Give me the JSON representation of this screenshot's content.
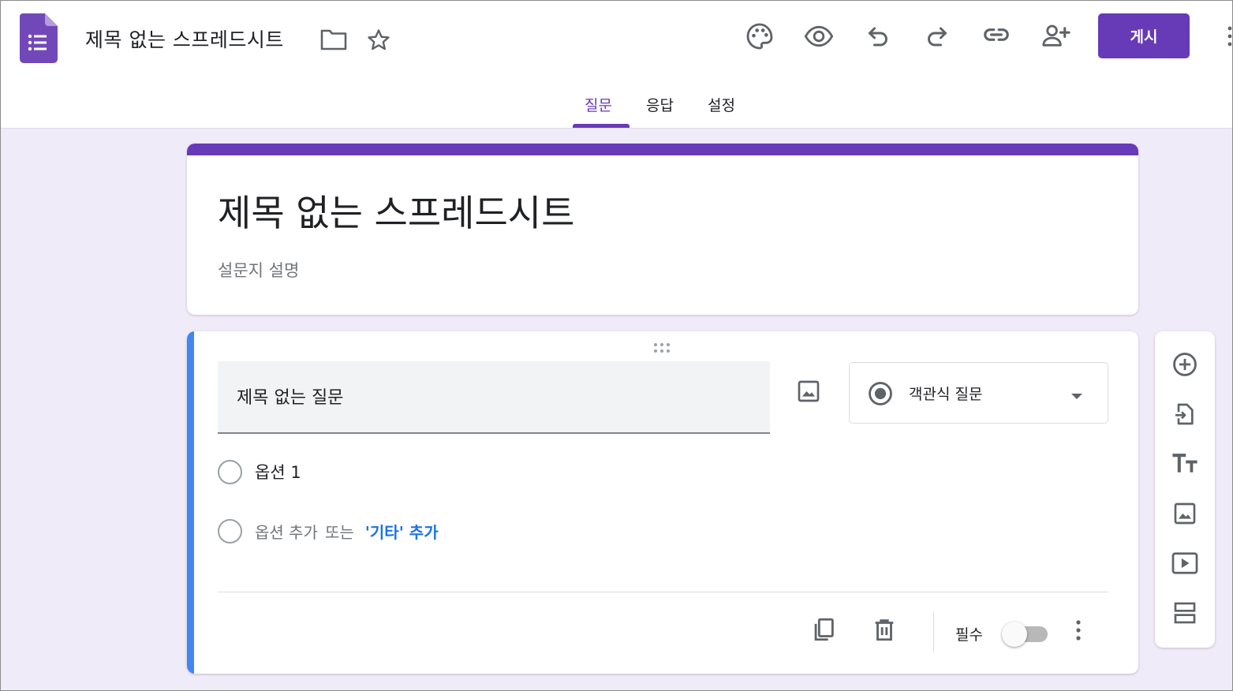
{
  "header": {
    "doc_title": "제목 없는 스프레드시트",
    "publish_label": "게시",
    "icons": [
      "forms-logo-icon",
      "folder-icon",
      "star-icon",
      "palette-icon",
      "preview-eye-icon",
      "undo-icon",
      "redo-icon",
      "link-icon",
      "add-collaborator-icon",
      "more-vert-icon"
    ],
    "accent_color": "#673ab7"
  },
  "tabs": [
    {
      "label": "질문",
      "active": true
    },
    {
      "label": "응답",
      "active": false
    },
    {
      "label": "설정",
      "active": false
    }
  ],
  "form": {
    "title": "제목 없는 스프레드시트",
    "description_placeholder": "설문지 설명"
  },
  "question": {
    "title": "제목 없는 질문",
    "type_label": "객관식 질문",
    "options": [
      {
        "label": "옵션 1"
      }
    ],
    "add_option_text": "옵션 추가",
    "or_text": "또는",
    "add_other_text": "'기타' 추가",
    "required_label": "필수",
    "required": false,
    "accent_color": "#4285f4"
  },
  "side_toolbar": {
    "icons": [
      "add-question-icon",
      "import-questions-icon",
      "add-title-icon",
      "add-image-icon",
      "add-video-icon",
      "add-section-icon"
    ]
  }
}
